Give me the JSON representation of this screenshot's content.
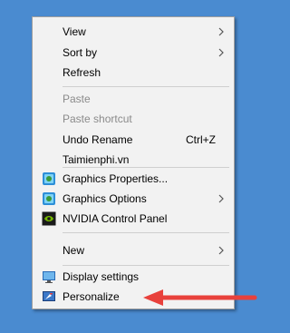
{
  "menu": {
    "view": "View",
    "sort_by": "Sort by",
    "refresh": "Refresh",
    "paste": "Paste",
    "paste_shortcut": "Paste shortcut",
    "undo_rename": "Undo Rename",
    "undo_rename_shortcut": "Ctrl+Z",
    "taimienphi": "Taimienphi.vn",
    "graphics_properties": "Graphics Properties...",
    "graphics_options": "Graphics Options",
    "nvidia_control_panel": "NVIDIA Control Panel",
    "new": "New",
    "display_settings": "Display settings",
    "personalize": "Personalize"
  },
  "icons": {
    "graphics_properties": "intel-graphics-icon",
    "graphics_options": "intel-graphics-icon",
    "nvidia_control_panel": "nvidia-icon",
    "display_settings": "monitor-icon",
    "personalize": "personalize-icon",
    "submenu": "chevron-right-icon"
  },
  "colors": {
    "desktop_background": "#4a8bd0",
    "menu_background": "#f2f2f2",
    "disabled_text": "#8a8a8a",
    "annotation_arrow": "#e8413c"
  }
}
